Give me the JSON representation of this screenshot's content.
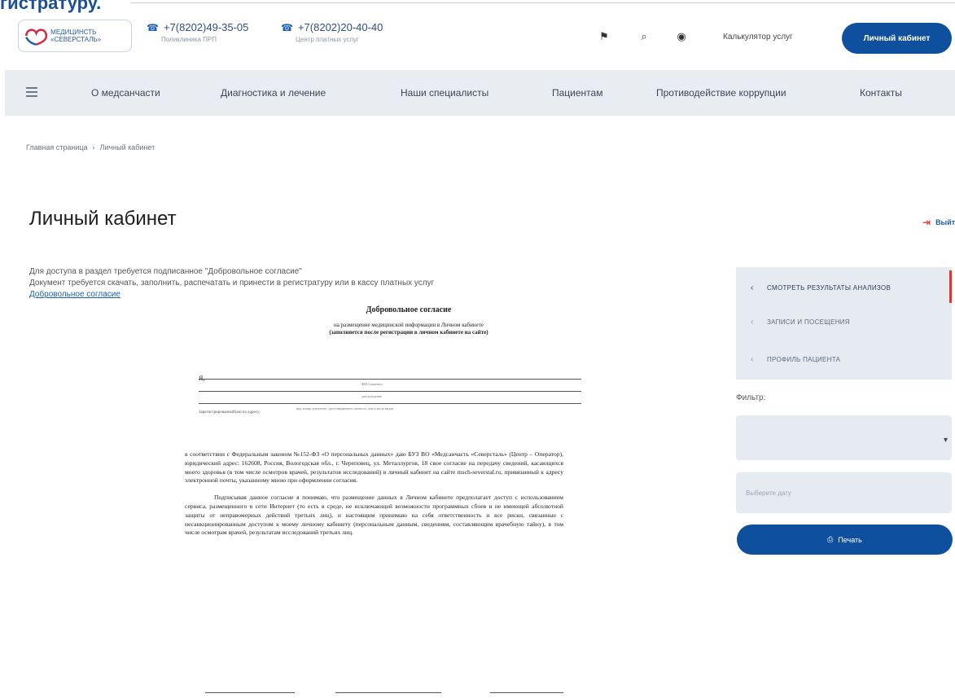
{
  "top_leak": "гистратуру.",
  "header": {
    "logo_text": "МЕДИЦИНСТЬ «СЕВЕРСТАЛЬ»",
    "phones": [
      {
        "number": "+7(8202)49-35-05",
        "caption": "Поликлиника ПРП"
      },
      {
        "number": "+7(8202)20-40-40",
        "caption": "Центр платных услуг"
      }
    ],
    "icons": [
      "flag-icon",
      "search-icon",
      "eye-icon"
    ],
    "calculator_label": "Калькулятор услуг",
    "cabinet_button": "Личный кабинет"
  },
  "nav": {
    "items": [
      "О медсанчасти",
      "Диагностика и лечение",
      "Наши специалисты",
      "Пациентам",
      "Противодействие коррупции",
      "Контакты"
    ]
  },
  "breadcrumb": {
    "home": "Главная страница",
    "separator": "›",
    "current": "Личный кабинет"
  },
  "page": {
    "title": "Личный кабинет",
    "logout": "Выйти"
  },
  "info": {
    "line1": "Для доступа в раздел требуется подписанное \"Добровольное согласие\"",
    "line2": "Документ требуется скачать, заполнить, распечатать и принести в регистратуру или в кассу платных услуг",
    "link": "Добровольное согласие"
  },
  "document": {
    "title": "Добровольное согласие",
    "subtitle": "на размещение медицинской информации в Личном кабинете",
    "subtitle2": "(заполняется после регистрации в личном кабинете на сайте)",
    "label_i": "Я,",
    "caption_fio": "ФИО пациента",
    "caption_dob": "дата рождения",
    "caption_doc": "вид, номер документа, удостоверяющего личность, кем и когда выдан",
    "address_label": "Зарегистрированный(ая) по адресу:",
    "para1": "в соответствии с Федеральным законом №152-ФЗ «О персональных данных» даю БУЗ ВО «Медсанчасть «Северсталь» (Центр – Оператор), юридический адрес: 162608, Россия, Вологодская обл., г. Череповец, ул. Металлургов, 18 свое согласие на передачу сведений, касающихся моего здоровья (в том числе осмотров врачей, результатов исследований) в личный кабинет на сайте msch-severstal.ru, привязанный к адресу электронной почты, указанному мною при оформлении согласия.",
    "para2": "Подписывая данное согласие я понимаю, что размещение данных в Личном кабинете предполагает доступ с использованием сервиса, размещенного в сети Интернет (то есть в среде, не исключающей возможности программных сбоев и не имеющей абсолютной защиты от неправомерных действий третьих лиц), и настоящим принимаю на себя ответственность и все риски, связанные с несанкционированным доступом к моему личному кабинету (персональным данным, сведениям, составляющим врачебную тайну), в том числе осмотрам врачей, результатам исследований третьих лиц."
  },
  "sidebar": {
    "items": [
      {
        "label": "СМОТРЕТЬ РЕЗУЛЬТАТЫ АНАЛИЗОВ",
        "active": true
      },
      {
        "label": "ЗАПИСИ И ПОСЕЩЕНИЯ",
        "active": false
      },
      {
        "label": "ПРОФИЛЬ ПАЦИЕНТА",
        "active": false
      }
    ],
    "filter_label": "Фильтр:",
    "date_placeholder": "Выберите дату",
    "print_button": "Печать"
  },
  "colors": {
    "primary": "#0e4f9e",
    "nav_bg": "#e9edf2",
    "accent_red": "#e0342c"
  }
}
